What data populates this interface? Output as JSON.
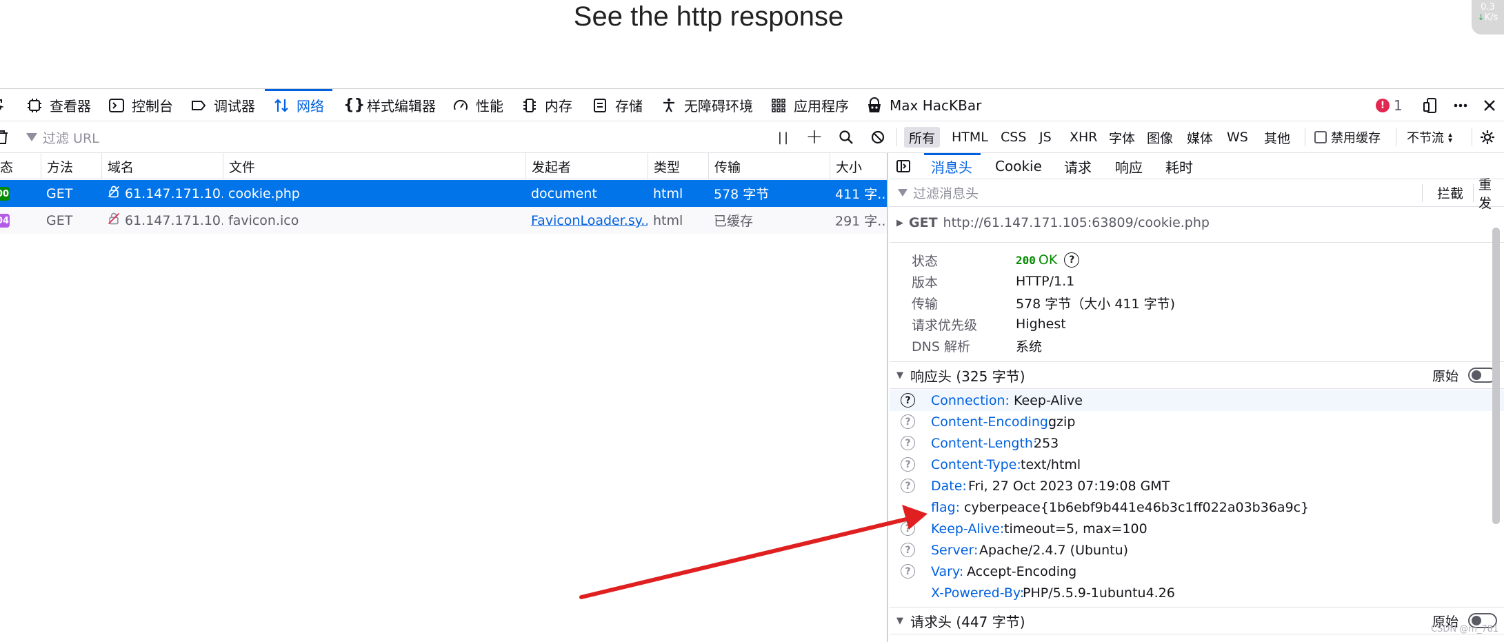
{
  "page": {
    "title": "See the http response"
  },
  "speed_widget": {
    "value": "0.3",
    "unit": "K/s"
  },
  "toolbar": {
    "tabs": [
      {
        "label": "查看器",
        "icon": "inspector-icon"
      },
      {
        "label": "控制台",
        "icon": "console-icon"
      },
      {
        "label": "调试器",
        "icon": "debugger-icon"
      },
      {
        "label": "网络",
        "icon": "network-icon",
        "active": true
      },
      {
        "label": "样式编辑器",
        "icon": "style-editor-icon"
      },
      {
        "label": "性能",
        "icon": "performance-icon"
      },
      {
        "label": "内存",
        "icon": "memory-icon"
      },
      {
        "label": "存储",
        "icon": "storage-icon"
      },
      {
        "label": "无障碍环境",
        "icon": "accessibility-icon"
      },
      {
        "label": "应用程序",
        "icon": "application-icon"
      },
      {
        "label": "Max HacKBar",
        "icon": "hackbar-icon"
      }
    ],
    "error_count": "1"
  },
  "filterbar": {
    "placeholder": "过滤 URL",
    "types": [
      "所有",
      "HTML",
      "CSS",
      "JS",
      "XHR",
      "字体",
      "图像",
      "媒体",
      "WS",
      "其他"
    ],
    "disable_cache_label": "禁用缓存",
    "throttle_label": "不节流"
  },
  "table": {
    "columns": [
      "态",
      "方法",
      "域名",
      "文件",
      "发起者",
      "类型",
      "传输",
      "大小"
    ],
    "rows": [
      {
        "status": "00",
        "method": "GET",
        "domain": "61.147.171.10...",
        "file": "cookie.php",
        "initiator": "document",
        "type": "html",
        "transfer": "578 字节",
        "size": "411 字..."
      },
      {
        "status": "04",
        "method": "GET",
        "domain": "61.147.171.10...",
        "file": "favicon.ico",
        "initiator": "FaviconLoader.sy...",
        "type": "html",
        "transfer": "已缓存",
        "size": "291 字..."
      }
    ]
  },
  "details": {
    "tabs": [
      "消息头",
      "Cookie",
      "请求",
      "响应",
      "耗时"
    ],
    "filter_placeholder": "过滤消息头",
    "block_label": "拦截",
    "resend_label": "重发",
    "request_line": {
      "method": "GET",
      "url": "http://61.147.171.105:63809/cookie.php"
    },
    "summary": [
      {
        "k": "状态",
        "v": "OK",
        "code": "200"
      },
      {
        "k": "版本",
        "v": "HTTP/1.1"
      },
      {
        "k": "传输",
        "v": "578 字节（大小 411 字节)"
      },
      {
        "k": "请求优先级",
        "v": "Highest"
      },
      {
        "k": "DNS 解析",
        "v": "系统"
      }
    ],
    "response_headers_title": "响应头 (325 字节)",
    "raw_label": "原始",
    "response_headers": [
      {
        "name": "Connection:",
        "value": "Keep-Alive",
        "help": true
      },
      {
        "name": "Content-Encoding:",
        "value": "gzip",
        "help": true
      },
      {
        "name": "Content-Length:",
        "value": "253",
        "help": true
      },
      {
        "name": "Content-Type:",
        "value": "text/html",
        "help": true
      },
      {
        "name": "Date:",
        "value": "Fri, 27 Oct 2023 07:19:08 GMT",
        "help": true
      },
      {
        "name": "flag:",
        "value": "cyberpeace{1b6ebf9b441e46b3c1ff022a03b36a9c}",
        "help": false
      },
      {
        "name": "Keep-Alive:",
        "value": "timeout=5, max=100",
        "help": true
      },
      {
        "name": "Server:",
        "value": "Apache/2.4.7 (Ubuntu)",
        "help": true
      },
      {
        "name": "Vary:",
        "value": "Accept-Encoding",
        "help": true
      },
      {
        "name": "X-Powered-By:",
        "value": "PHP/5.5.9-1ubuntu4.26",
        "help": false
      }
    ],
    "request_headers_title": "请求头 (447 字节)"
  },
  "watermark": "CSDN @m_781",
  "colors": {
    "accent": "#0061e0",
    "selected_row": "#0074e8",
    "status_ok": "#058b00",
    "status_cached": "#b45be6",
    "annotation_arrow": "#e02020"
  }
}
